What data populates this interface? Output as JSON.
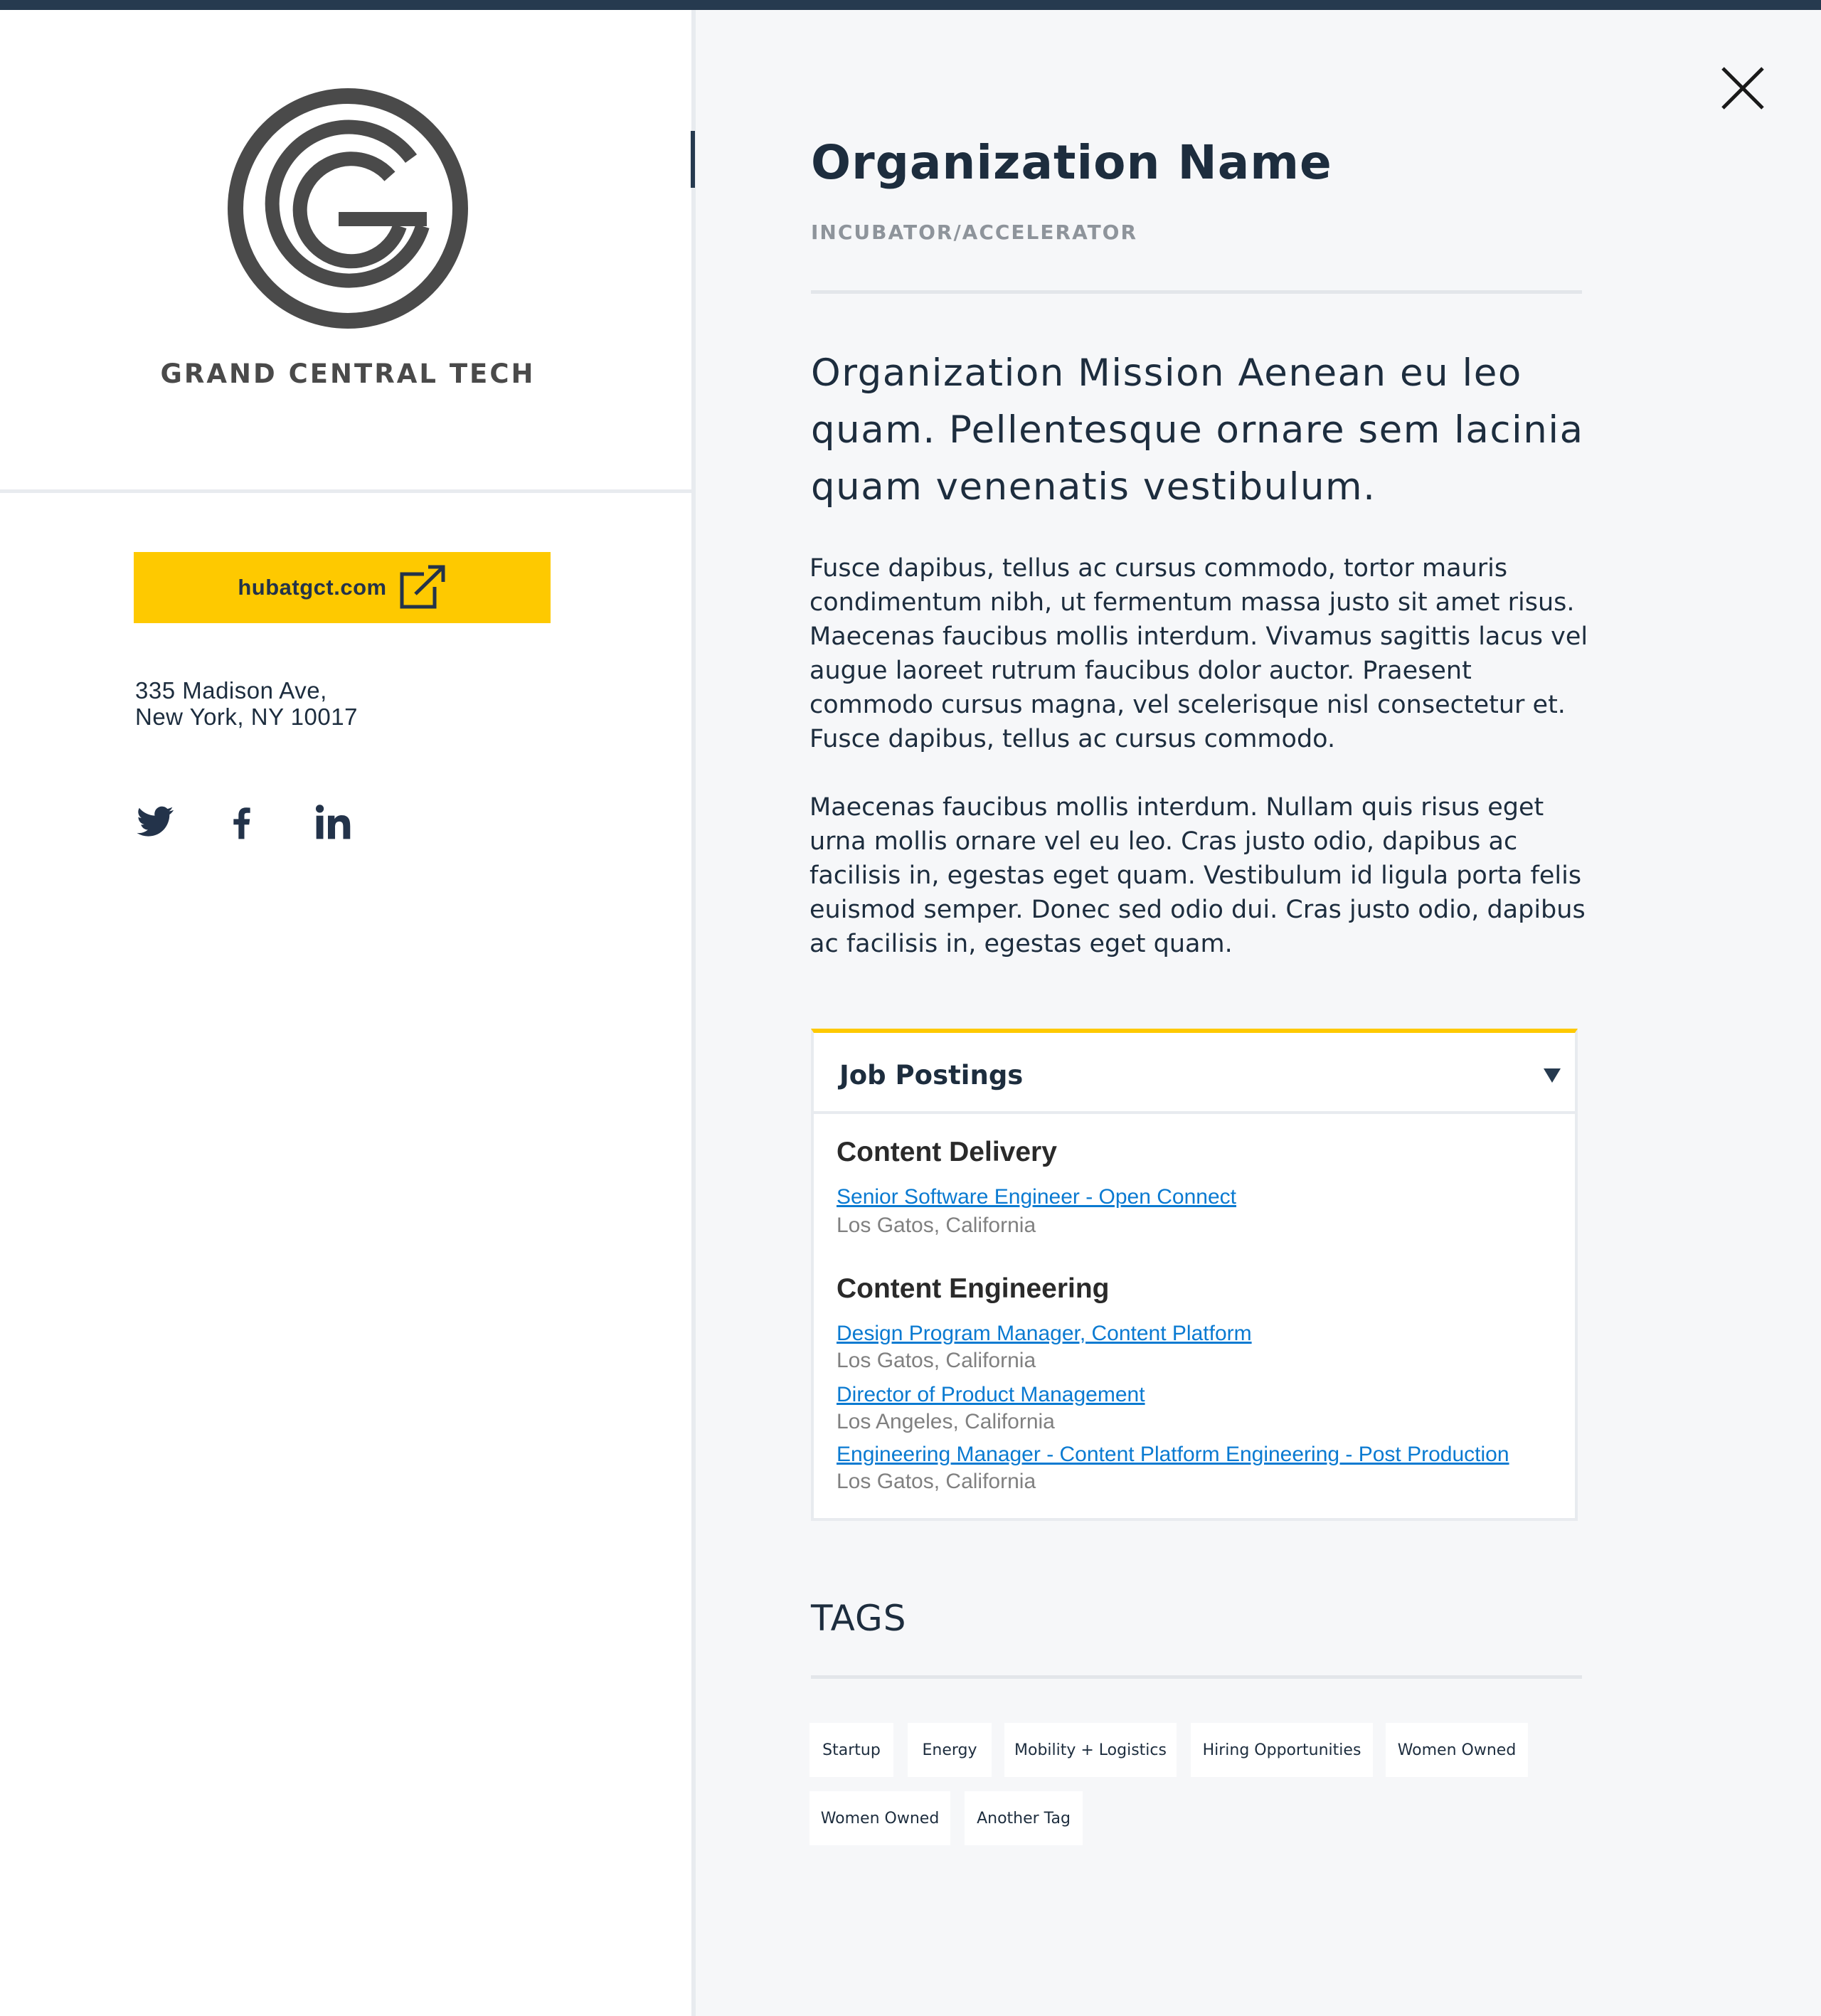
{
  "organization": {
    "name": "Organization Name",
    "type": "INCUBATOR/ACCELERATOR",
    "logo_text": "GRAND CENTRAL TECH",
    "mission": "Organization Mission Aenean eu leo quam. Pellentesque ornare sem lacinia quam venenatis vestibulum.",
    "paragraphs": [
      "Fusce dapibus, tellus ac cursus commodo, tortor mauris condimentum nibh, ut fermentum massa justo sit amet risus. Maecenas faucibus mollis interdum. Vivamus sagittis lacus vel augue laoreet rutrum faucibus dolor auctor. Praesent commodo cursus magna, vel scelerisque nisl consectetur et. Fusce dapibus, tellus ac cursus commodo.",
      "Maecenas faucibus mollis interdum. Nullam quis risus eget urna mollis ornare vel eu leo. Cras justo odio, dapibus ac facilisis in, egestas eget quam. Vestibulum id ligula porta felis euismod semper. Donec sed odio dui. Cras justo odio, dapibus ac facilisis in, egestas eget quam."
    ]
  },
  "contact": {
    "website_label": "hubatgct.com",
    "address_line1": "335 Madison Ave,",
    "address_line2": "New York, NY 10017",
    "social_icons": [
      "twitter-icon",
      "facebook-icon",
      "linkedin-icon"
    ]
  },
  "jobs": {
    "title": "Job Postings",
    "departments": [
      {
        "name": "Content Delivery",
        "postings": [
          {
            "title": "Senior Software Engineer - Open Connect",
            "location": "Los Gatos, California"
          }
        ]
      },
      {
        "name": "Content Engineering",
        "postings": [
          {
            "title": "Design Program Manager, Content Platform",
            "location": "Los Gatos, California"
          },
          {
            "title": "Director of Product Management",
            "location": "Los Angeles, California"
          },
          {
            "title": "Engineering Manager - Content Platform Engineering - Post Production",
            "location": "Los Gatos, California"
          }
        ]
      }
    ]
  },
  "tags": {
    "title": "TAGS",
    "items": [
      "Startup",
      "Energy",
      "Mobility + Logistics",
      "Hiring Opportunities",
      "Women Owned",
      "Women Owned",
      "Another Tag"
    ]
  },
  "colors": {
    "accent_yellow": "#fec900",
    "navy": "#263a4f",
    "link_blue": "#0a7ad1"
  }
}
